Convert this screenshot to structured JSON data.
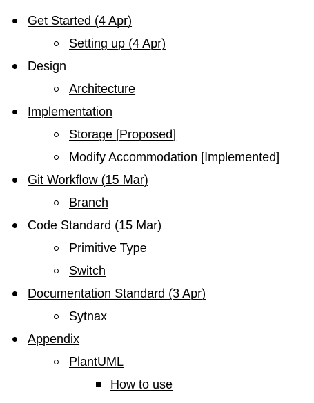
{
  "toc": {
    "items": [
      {
        "label": "Get Started (4 Apr)",
        "level": 1
      },
      {
        "label": "Setting up (4 Apr)",
        "level": 2
      },
      {
        "label": "Design",
        "level": 1
      },
      {
        "label": "Architecture",
        "level": 2
      },
      {
        "label": "Implementation",
        "level": 1
      },
      {
        "label": "Storage [Proposed]",
        "level": 2
      },
      {
        "label": "Modify Accommodation [Implemented]",
        "level": 2
      },
      {
        "label": "Git Workflow (15 Mar)",
        "level": 1
      },
      {
        "label": "Branch",
        "level": 2
      },
      {
        "label": "Code Standard (15 Mar)",
        "level": 1
      },
      {
        "label": "Primitive Type",
        "level": 2
      },
      {
        "label": "Switch",
        "level": 2
      },
      {
        "label": "Documentation Standard (3 Apr)",
        "level": 1
      },
      {
        "label": "Sytnax",
        "level": 2
      },
      {
        "label": "Appendix",
        "level": 1
      },
      {
        "label": "PlantUML",
        "level": 2
      },
      {
        "label": "How to use",
        "level": 3
      }
    ]
  }
}
